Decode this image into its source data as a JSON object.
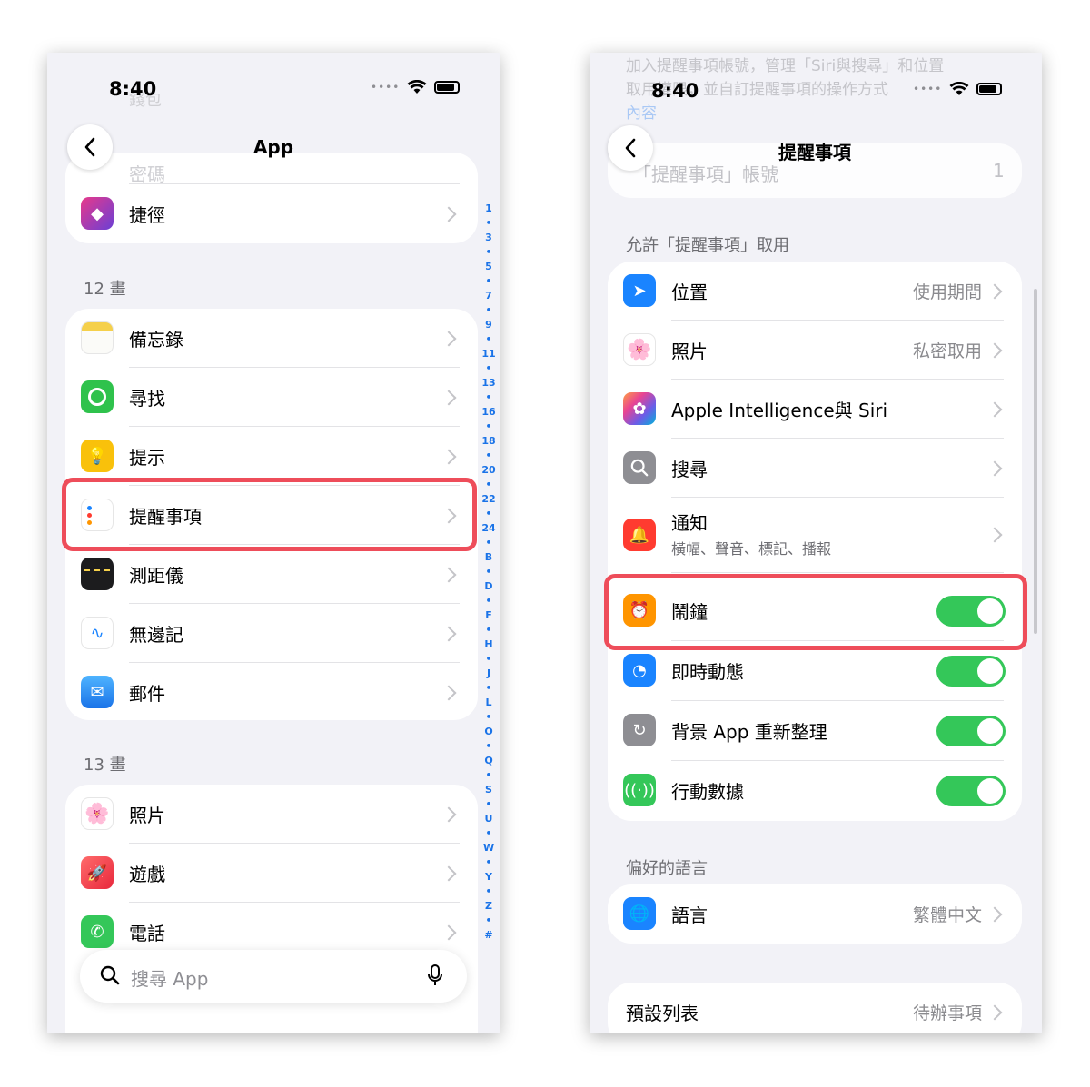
{
  "left": {
    "status": {
      "time": "8:40"
    },
    "nav": {
      "title": "App"
    },
    "faded": {
      "top_label": "錢包",
      "row_label": "密碼"
    },
    "top_group": {
      "label": "捷徑"
    },
    "section12": {
      "header": "12 畫",
      "items": [
        {
          "label": "備忘錄",
          "icon": "notes-icon"
        },
        {
          "label": "尋找",
          "icon": "findmy-icon"
        },
        {
          "label": "提示",
          "icon": "tips-icon"
        },
        {
          "label": "提醒事項",
          "icon": "reminders-icon"
        },
        {
          "label": "測距儀",
          "icon": "measure-icon"
        },
        {
          "label": "無邊記",
          "icon": "freeform-icon"
        },
        {
          "label": "郵件",
          "icon": "mail-icon"
        }
      ]
    },
    "section13": {
      "header": "13 畫",
      "items": [
        {
          "label": "照片",
          "icon": "photos-icon"
        },
        {
          "label": "遊戲",
          "icon": "games-icon"
        },
        {
          "label": "電話",
          "icon": "phone-icon"
        }
      ]
    },
    "index": [
      "1",
      "3",
      "5",
      "7",
      "9",
      "11",
      "13",
      "16",
      "18",
      "20",
      "22",
      "24",
      "B",
      "D",
      "F",
      "H",
      "J",
      "L",
      "O",
      "Q",
      "S",
      "U",
      "W",
      "Y",
      "Z",
      "#"
    ],
    "search": {
      "placeholder": "搜尋 App"
    }
  },
  "right": {
    "status": {
      "time": "8:40"
    },
    "nav": {
      "title": "提醒事項"
    },
    "faded": {
      "text1": "加入提醒事項帳號，管理「Siri與搜尋」和位置",
      "text2": "取用權限，並自訂提醒事項的操作方式",
      "link": "內容",
      "account_row": "「提醒事項」帳號",
      "account_count": "1"
    },
    "allow": {
      "header": "允許「提醒事項」取用",
      "items": [
        {
          "label": "位置",
          "value": "使用期間",
          "icon": "location-icon"
        },
        {
          "label": "照片",
          "value": "私密取用",
          "icon": "photos-icon"
        },
        {
          "label": "Apple Intelligence與 Siri",
          "value": "",
          "icon": "siri-icon"
        },
        {
          "label": "搜尋",
          "value": "",
          "icon": "search-icon"
        },
        {
          "label": "通知",
          "sub": "橫幅、聲音、標記、播報",
          "icon": "notification-icon"
        },
        {
          "label": "鬧鐘",
          "toggle": "on",
          "icon": "alarm-icon"
        },
        {
          "label": "即時動態",
          "toggle": "on",
          "icon": "live-activity-icon"
        },
        {
          "label": "背景 App 重新整理",
          "toggle": "on",
          "icon": "refresh-icon"
        },
        {
          "label": "行動數據",
          "toggle": "on",
          "icon": "cellular-icon"
        }
      ]
    },
    "lang": {
      "header": "偏好的語言",
      "label": "語言",
      "value": "繁體中文"
    },
    "default_list": {
      "label": "預設列表",
      "value": "待辦事項"
    }
  },
  "colors": {
    "highlight": "#ee4d5a",
    "toggle_on": "#34c759",
    "index": "#1a73e8"
  }
}
